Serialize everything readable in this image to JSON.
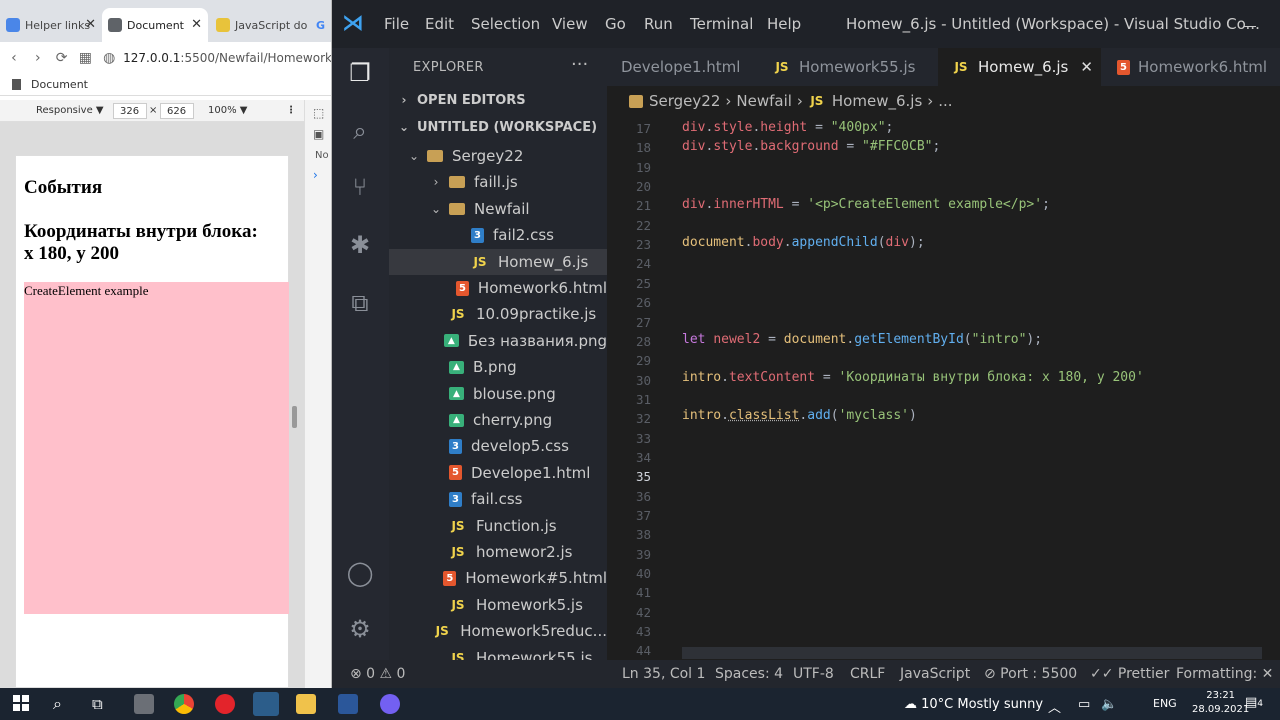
{
  "browser": {
    "tabs": [
      {
        "label": "Helper links"
      },
      {
        "label": "Document"
      },
      {
        "label": "JavaScript do"
      },
      {
        "label": "G"
      }
    ],
    "url": "127.0.0.1:5500/Newfail/Homework",
    "url_host": "127.0.0.1",
    "url_rest": ":5500/Newfail/Homework",
    "bookmark": "Document",
    "devtools": {
      "device": "Responsive ▼",
      "width": "326",
      "x": "×",
      "height": "626",
      "zoom": "100% ▼",
      "side1": "No",
      "side2": "›"
    },
    "page": {
      "h1_a": "События",
      "h1_b": "Координаты внутри блока:",
      "h1_c": "x 180, y 200",
      "box_text": "CreateElement example"
    }
  },
  "vscode": {
    "menu": [
      "File",
      "Edit",
      "Selection",
      "View",
      "Go",
      "Run",
      "Terminal",
      "Help"
    ],
    "title": "Homew_6.js - Untitled (Workspace) - Visual Studio Co...",
    "explorer_label": "EXPLORER",
    "explorer_dots": "···",
    "open_editors": "OPEN EDITORS",
    "workspace": "UNTITLED (WORKSPACE)",
    "tree": [
      {
        "name": "Sergey22",
        "type": "folder-open",
        "indent": 0
      },
      {
        "name": "faill.js",
        "type": "folder",
        "indent": 1
      },
      {
        "name": "Newfail",
        "type": "folder-open",
        "indent": 1
      },
      {
        "name": "fail2.css",
        "type": "css",
        "indent": 2
      },
      {
        "name": "Homew_6.js",
        "type": "js",
        "indent": 2,
        "selected": true
      },
      {
        "name": "Homework6.html",
        "type": "html",
        "indent": 2
      },
      {
        "name": "10.09practike.js",
        "type": "js",
        "indent": 1
      },
      {
        "name": "Без названия.png",
        "type": "img",
        "indent": 1
      },
      {
        "name": "B.png",
        "type": "img",
        "indent": 1
      },
      {
        "name": "blouse.png",
        "type": "img",
        "indent": 1
      },
      {
        "name": "cherry.png",
        "type": "img",
        "indent": 1
      },
      {
        "name": "develop5.css",
        "type": "css",
        "indent": 1
      },
      {
        "name": "Develope1.html",
        "type": "html",
        "indent": 1
      },
      {
        "name": "fail.css",
        "type": "css",
        "indent": 1
      },
      {
        "name": "Function.js",
        "type": "js",
        "indent": 1
      },
      {
        "name": "homewor2.js",
        "type": "js",
        "indent": 1
      },
      {
        "name": "Homework#5.html",
        "type": "html",
        "indent": 1
      },
      {
        "name": "Homework5.js",
        "type": "js",
        "indent": 1
      },
      {
        "name": "Homework5reduc...",
        "type": "js",
        "indent": 1
      },
      {
        "name": "Homework55.js",
        "type": "js",
        "indent": 1
      }
    ],
    "tabs": [
      {
        "name": "Develope1.html",
        "type": "none"
      },
      {
        "name": "Homework55.js",
        "type": "js"
      },
      {
        "name": "Homew_6.js",
        "type": "js",
        "active": true
      },
      {
        "name": "Homework6.html",
        "type": "html"
      }
    ],
    "breadcrumb": [
      "Sergey22",
      "Newfail",
      "Homew_6.js",
      "..."
    ],
    "lines": [
      "17",
      "18",
      "19",
      "20",
      "21",
      "22",
      "23",
      "24",
      "25",
      "26",
      "27",
      "28",
      "29",
      "30",
      "31",
      "32",
      "33",
      "34",
      "35",
      "36",
      "37",
      "38",
      "39",
      "40",
      "41",
      "42",
      "43",
      "44"
    ],
    "current_line": "35",
    "code": {
      "l17": "div.style.height = \"400px\";",
      "l18": "div.style.background = \"#FFC0CB\";",
      "l21": "div.innerHTML = '<p>CreateElement example</p>';",
      "l23": "document.body.appendChild(div);",
      "l28": "let newel2 = document.getElementById(\"intro\");",
      "l30": "intro.textContent = 'Координаты внутри блока: x 180, y 200'",
      "l32": "intro.classList.add('myclass')"
    },
    "status": {
      "problems": "⊗ 0 ⚠ 0",
      "pos": "Ln 35, Col 1",
      "spaces": "Spaces: 4",
      "enc": "UTF-8",
      "eol": "CRLF",
      "lang": "JavaScript",
      "port": "⊘ Port : 5500",
      "prettier": "✓✓ Prettier",
      "formatting": "Formatting: ✕"
    }
  },
  "taskbar": {
    "weather": "10°C  Mostly sunny",
    "lang": "ENG",
    "time": "23:21",
    "date": "28.09.2021",
    "notif": "4"
  }
}
